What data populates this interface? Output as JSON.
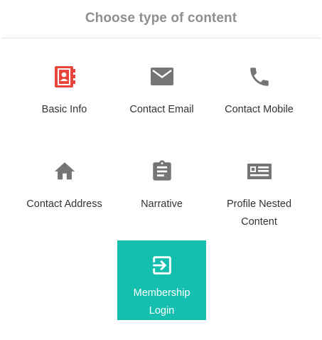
{
  "dialog": {
    "title": "Choose type of content"
  },
  "tiles": [
    {
      "line1": "Basic Info",
      "line2": "",
      "icon": "contact-book-icon",
      "icon_color": "#e8453c"
    },
    {
      "line1": "Contact Email",
      "line2": "",
      "icon": "envelope-icon",
      "icon_color": "#757575"
    },
    {
      "line1": "Contact Mobile",
      "line2": "",
      "icon": "phone-icon",
      "icon_color": "#757575"
    },
    {
      "line1": "Contact Address",
      "line2": "",
      "icon": "home-icon",
      "icon_color": "#757575"
    },
    {
      "line1": "Narrative",
      "line2": "",
      "icon": "clipboard-icon",
      "icon_color": "#757575"
    },
    {
      "line1": "Profile Nested",
      "line2": "Content",
      "icon": "id-card-icon",
      "icon_color": "#757575"
    },
    {
      "line1": "Membership",
      "line2": "Login",
      "icon": "login-icon",
      "icon_color": "#ffffff",
      "selected": true,
      "highlight_color": "#14bfb0"
    }
  ]
}
